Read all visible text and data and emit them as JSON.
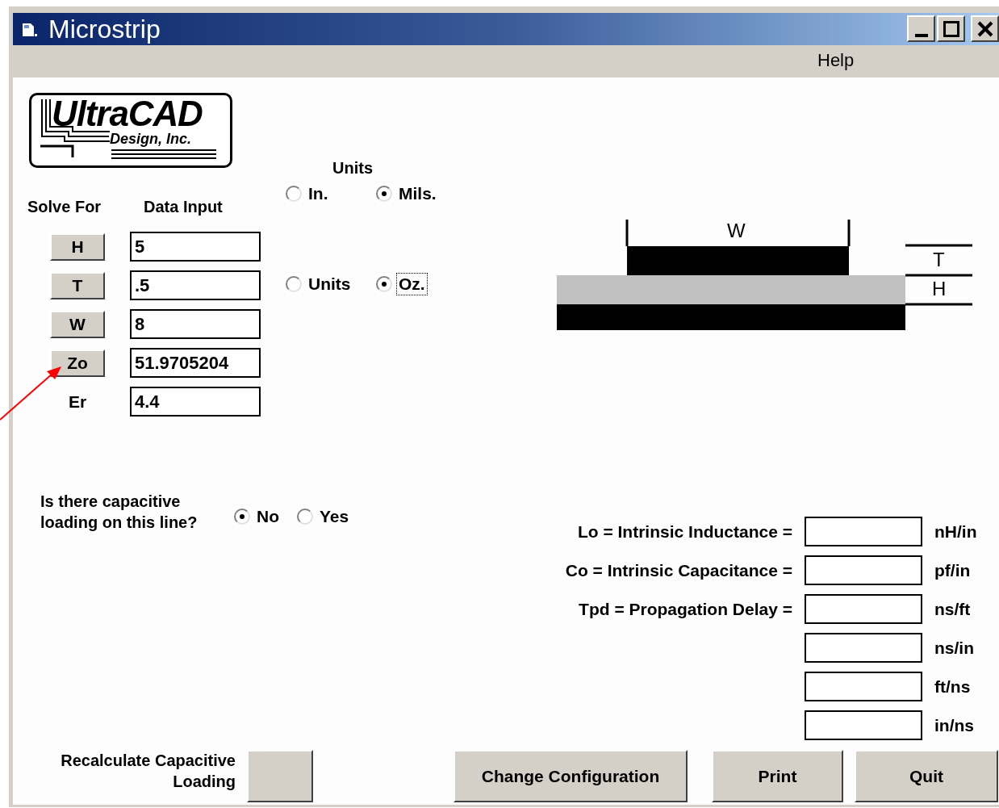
{
  "window": {
    "title": "Microstrip"
  },
  "menu": [
    {
      "label": "Help"
    }
  ],
  "logo": {
    "name": "UltraCAD",
    "subtitle": "Design, Inc."
  },
  "units": {
    "label": "Units",
    "options": [
      {
        "label": "In.",
        "selected": false,
        "focused": false
      },
      {
        "label": "Mils.",
        "selected": true,
        "focused": false
      }
    ]
  },
  "thickness_units": {
    "options": [
      {
        "label": "Units",
        "selected": false,
        "focused": false
      },
      {
        "label": "Oz.",
        "selected": true,
        "focused": true
      }
    ]
  },
  "columns": {
    "solve_for": "Solve For",
    "data_input": "Data Input"
  },
  "parameters": [
    {
      "kind": "button",
      "label": "H",
      "value": "5"
    },
    {
      "kind": "button",
      "label": "T",
      "value": ".5"
    },
    {
      "kind": "button",
      "label": "W",
      "value": "8"
    },
    {
      "kind": "button",
      "label": "Zo",
      "value": "51.9705204"
    },
    {
      "kind": "label",
      "label": "Er",
      "value": "4.4"
    }
  ],
  "diagram": {
    "width_label": "W",
    "thickness_label": "T",
    "height_label": "H"
  },
  "capacitive_loading": {
    "question": "Is there capacitive loading on this line?",
    "options": [
      {
        "label": "No",
        "selected": true
      },
      {
        "label": "Yes",
        "selected": false
      }
    ]
  },
  "outputs": [
    {
      "label": "Lo = Intrinsic Inductance =",
      "unit": "nH/in"
    },
    {
      "label": "Co = Intrinsic Capacitance =",
      "unit": "pf/in"
    },
    {
      "label": "Tpd = Propagation Delay =",
      "unit": "ns/ft"
    },
    {
      "unit": "ns/in"
    },
    {
      "unit": "ft/ns"
    },
    {
      "unit": "in/ns"
    }
  ],
  "recalculate": {
    "label": "Recalculate Capacitive Loading"
  },
  "buttons": [
    "Change Configuration",
    "Print",
    "Quit"
  ]
}
